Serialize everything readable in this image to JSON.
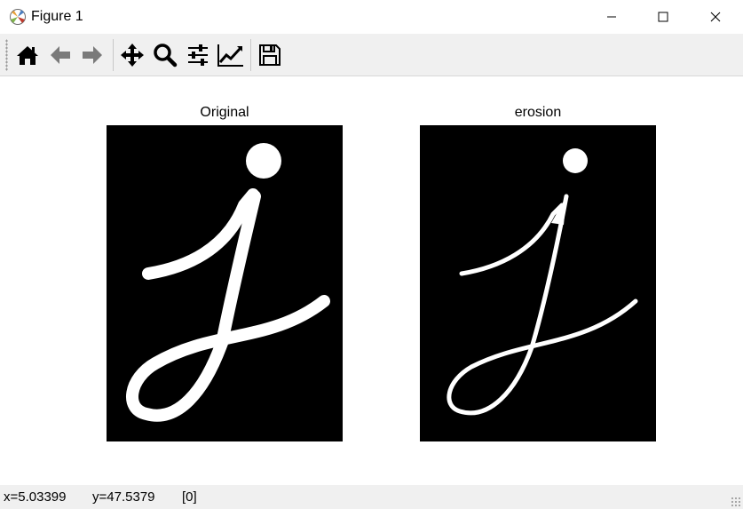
{
  "window": {
    "title": "Figure 1",
    "controls": [
      "minimize",
      "maximize",
      "close"
    ]
  },
  "toolbar": {
    "buttons": [
      {
        "icon": "home-icon"
      },
      {
        "icon": "back-arrow-icon"
      },
      {
        "icon": "forward-arrow-icon"
      },
      {
        "icon": "pan-move-icon"
      },
      {
        "icon": "zoom-magnifier-icon"
      },
      {
        "icon": "configure-subplots-icon"
      },
      {
        "icon": "edit-axis-icon"
      },
      {
        "icon": "save-disk-icon"
      }
    ]
  },
  "figure": {
    "axes": [
      {
        "title": "Original"
      },
      {
        "title": "erosion"
      }
    ]
  },
  "status": {
    "x": "x=5.03399",
    "y": "y=47.5379",
    "value": "[0]"
  },
  "colors": {
    "toolbar_bg": "#f0f0f0",
    "image_bg": "#000000",
    "stroke": "#ffffff"
  }
}
